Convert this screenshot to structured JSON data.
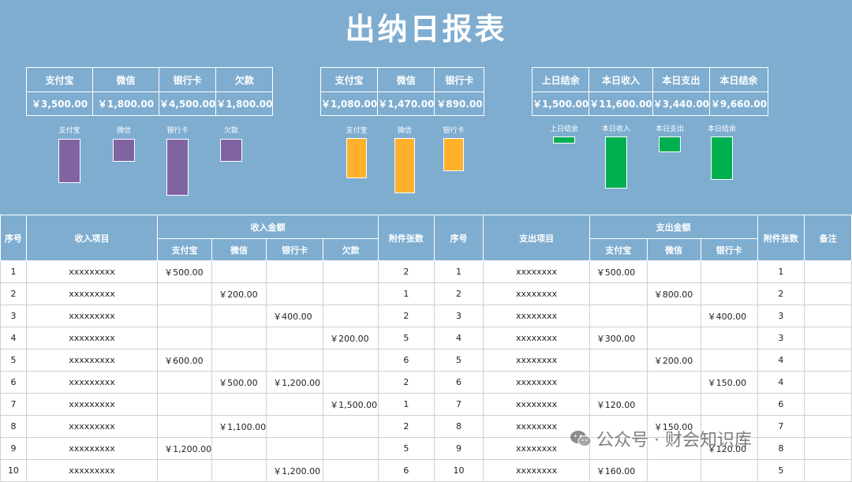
{
  "title": "出纳日报表",
  "summary_income": {
    "headers": [
      "支付宝",
      "微信",
      "银行卡",
      "欠款"
    ],
    "values": [
      "￥3,500.00",
      "￥1,800.00",
      "￥4,500.00",
      "￥1,800.00"
    ]
  },
  "summary_expense": {
    "headers": [
      "支付宝",
      "微信",
      "银行卡"
    ],
    "values": [
      "￥1,080.00",
      "￥1,470.00",
      "￥890.00"
    ]
  },
  "summary_balance": {
    "headers": [
      "上日结余",
      "本日收入",
      "本日支出",
      "本日结余"
    ],
    "values": [
      "￥1,500.00",
      "￥11,600.00",
      "￥3,440.00",
      "￥9,660.00"
    ]
  },
  "charts": [
    {
      "type": "bar",
      "color": "#8064a2",
      "categories": [
        "支付宝",
        "微信",
        "银行卡",
        "欠款"
      ],
      "values": [
        3500,
        1800,
        4500,
        1800
      ]
    },
    {
      "type": "bar",
      "color": "#ffb12b",
      "categories": [
        "支付宝",
        "微信",
        "银行卡"
      ],
      "values": [
        1080,
        1470,
        890
      ]
    },
    {
      "type": "bar",
      "color": "#00b050",
      "categories": [
        "上日结余",
        "本日收入",
        "本日支出",
        "本日结余"
      ],
      "values": [
        1500,
        11600,
        3440,
        9660
      ]
    }
  ],
  "table": {
    "h_seq": "序号",
    "h_income_item": "收入项目",
    "h_income_amount": "收入金额",
    "h_income_sub": [
      "支付宝",
      "微信",
      "银行卡",
      "欠款"
    ],
    "h_attach": "附件张数",
    "h_seq2": "序号",
    "h_expense_item": "支出项目",
    "h_expense_amount": "支出金额",
    "h_expense_sub": [
      "支付宝",
      "微信",
      "银行卡"
    ],
    "h_attach2": "附件张数",
    "h_note": "备注",
    "rows": [
      {
        "seq": "1",
        "item": "xxxxxxxxx",
        "inc": [
          "￥500.00",
          "",
          "",
          ""
        ],
        "att": "2",
        "seq2": "1",
        "item2": "xxxxxxxx",
        "exp": [
          "￥500.00",
          "",
          ""
        ],
        "att2": "1",
        "note": ""
      },
      {
        "seq": "2",
        "item": "xxxxxxxxx",
        "inc": [
          "",
          "￥200.00",
          "",
          ""
        ],
        "att": "1",
        "seq2": "2",
        "item2": "xxxxxxxx",
        "exp": [
          "",
          "￥800.00",
          ""
        ],
        "att2": "2",
        "note": ""
      },
      {
        "seq": "3",
        "item": "xxxxxxxxx",
        "inc": [
          "",
          "",
          "￥400.00",
          ""
        ],
        "att": "2",
        "seq2": "3",
        "item2": "xxxxxxxx",
        "exp": [
          "",
          "",
          "￥400.00"
        ],
        "att2": "3",
        "note": ""
      },
      {
        "seq": "4",
        "item": "xxxxxxxxx",
        "inc": [
          "",
          "",
          "",
          "￥200.00"
        ],
        "att": "5",
        "seq2": "4",
        "item2": "xxxxxxxx",
        "exp": [
          "￥300.00",
          "",
          ""
        ],
        "att2": "3",
        "note": ""
      },
      {
        "seq": "5",
        "item": "xxxxxxxxx",
        "inc": [
          "￥600.00",
          "",
          "",
          ""
        ],
        "att": "6",
        "seq2": "5",
        "item2": "xxxxxxxx",
        "exp": [
          "",
          "￥200.00",
          ""
        ],
        "att2": "4",
        "note": ""
      },
      {
        "seq": "6",
        "item": "xxxxxxxxx",
        "inc": [
          "",
          "￥500.00",
          "￥1,200.00",
          ""
        ],
        "att": "2",
        "seq2": "6",
        "item2": "xxxxxxxx",
        "exp": [
          "",
          "",
          "￥150.00"
        ],
        "att2": "4",
        "note": ""
      },
      {
        "seq": "7",
        "item": "xxxxxxxxx",
        "inc": [
          "",
          "",
          "",
          "￥1,500.00"
        ],
        "att": "1",
        "seq2": "7",
        "item2": "xxxxxxxx",
        "exp": [
          "￥120.00",
          "",
          ""
        ],
        "att2": "6",
        "note": ""
      },
      {
        "seq": "8",
        "item": "xxxxxxxxx",
        "inc": [
          "",
          "￥1,100.00",
          "",
          ""
        ],
        "att": "2",
        "seq2": "8",
        "item2": "xxxxxxxx",
        "exp": [
          "",
          "￥150.00",
          ""
        ],
        "att2": "7",
        "note": ""
      },
      {
        "seq": "9",
        "item": "xxxxxxxxx",
        "inc": [
          "￥1,200.00",
          "",
          "",
          ""
        ],
        "att": "5",
        "seq2": "9",
        "item2": "xxxxxxxx",
        "exp": [
          "",
          "",
          "￥120.00"
        ],
        "att2": "8",
        "note": ""
      },
      {
        "seq": "10",
        "item": "xxxxxxxxx",
        "inc": [
          "",
          "",
          "￥1,200.00",
          ""
        ],
        "att": "6",
        "seq2": "10",
        "item2": "xxxxxxxx",
        "exp": [
          "￥160.00",
          "",
          ""
        ],
        "att2": "5",
        "note": ""
      }
    ]
  },
  "watermark": {
    "text": "公众号 · 财会知识库",
    "icon": "wechat-icon"
  }
}
